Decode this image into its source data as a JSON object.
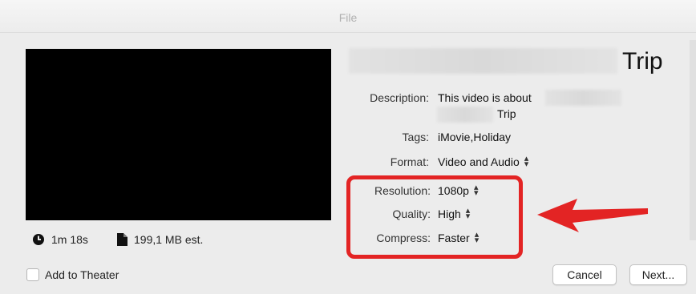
{
  "window": {
    "title": "File"
  },
  "video": {
    "title_suffix": "Trip"
  },
  "info": {
    "duration": "1m 18s",
    "size": "199,1 MB est."
  },
  "fields": {
    "description_label": "Description:",
    "description_value_line1": "This video is about",
    "description_value_line2": "Trip",
    "tags_label": "Tags:",
    "tags_value": "iMovie,Holiday",
    "format_label": "Format:",
    "format_value": "Video and Audio",
    "resolution_label": "Resolution:",
    "resolution_value": "1080p",
    "quality_label": "Quality:",
    "quality_value": "High",
    "compress_label": "Compress:",
    "compress_value": "Faster"
  },
  "footer": {
    "add_to_theater_label": "Add to Theater",
    "add_to_theater_checked": false,
    "cancel_label": "Cancel",
    "next_label": "Next..."
  },
  "colors": {
    "highlight": "#e32424",
    "background": "#ececec"
  },
  "icons": {
    "duration": "clock-icon",
    "size": "file-icon",
    "stepper": "up-down-stepper-icon"
  }
}
